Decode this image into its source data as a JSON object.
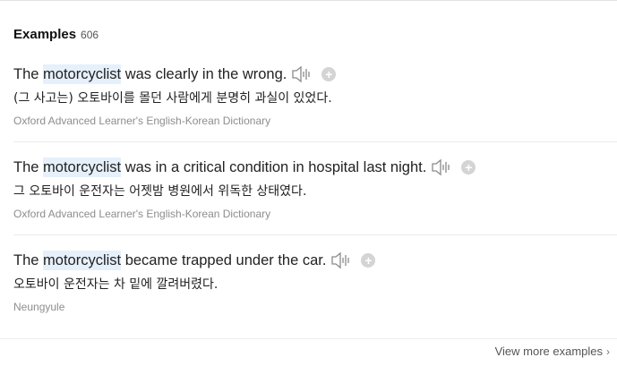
{
  "header": {
    "title": "Examples",
    "count": "606"
  },
  "examples": [
    {
      "prefix": "The ",
      "highlight": "motorcyclist",
      "suffix": " was clearly in the wrong.",
      "translation": "(그 사고는) 오토바이를 몰던 사람에게 분명히 과실이 있었다.",
      "source": "Oxford Advanced Learner's English-Korean Dictionary"
    },
    {
      "prefix": "The ",
      "highlight": "motorcyclist",
      "suffix": " was in a critical condition in hospital last night.",
      "translation": "그 오토바이 운전자는 어젯밤 병원에서 위독한 상태였다.",
      "source": "Oxford Advanced Learner's English-Korean Dictionary"
    },
    {
      "prefix": "The ",
      "highlight": "motorcyclist",
      "suffix": " became trapped under the car.",
      "translation": "오토바이 운전자는 차 밑에 깔려버렸다.",
      "source": "Neungyule"
    }
  ],
  "icons": {
    "audio": "speaker-icon",
    "add": "plus-circle-icon",
    "more": "chevron-right-icon"
  },
  "footer": {
    "view_more": "View more examples"
  },
  "colors": {
    "highlight": "#e6f0fb",
    "source_text": "#8d8d8d",
    "speaker_stroke": "#8a8a8a",
    "add_bg": "#d4d4d4"
  }
}
